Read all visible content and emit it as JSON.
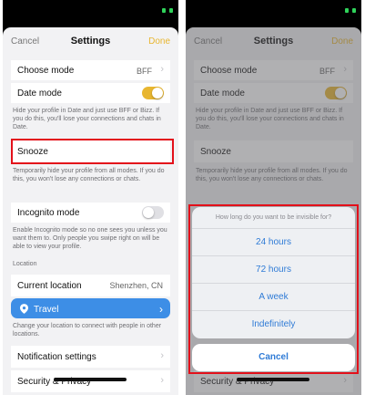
{
  "settings": {
    "cancel_label": "Cancel",
    "title": "Settings",
    "done_label": "Done",
    "choose_mode": {
      "label": "Choose mode",
      "value": "BFF"
    },
    "date_mode": {
      "label": "Date mode",
      "enabled": true,
      "description": "Hide your profile in Date and just use BFF or Bizz. If you do this, you'll lose your connections and chats in Date."
    },
    "snooze": {
      "label": "Snooze",
      "description": "Temporarily hide your profile from all modes. If you do this, you won't lose any connections or chats."
    },
    "incognito_mode": {
      "label": "Incognito mode",
      "enabled": false,
      "description": "Enable Incognito mode so no one sees you unless you want them to. Only people you swipe right on will be able to view your profile."
    },
    "location_section": "Location",
    "current_location": {
      "label": "Current location",
      "value": "Shenzhen, CN"
    },
    "travel": {
      "label": "Travel",
      "description": "Change your location to connect with people in other locations."
    },
    "notification_settings": "Notification settings",
    "security_privacy": "Security & Privacy"
  },
  "snooze_sheet": {
    "title": "How long do you want to be invisible for?",
    "options": [
      "24 hours",
      "72 hours",
      "A week",
      "Indefinitely"
    ],
    "cancel_label": "Cancel"
  },
  "colors": {
    "accent_yellow": "#e8b630",
    "travel_blue": "#3d8ee6",
    "action_blue": "#2f7bd6",
    "highlight_red": "#e3101a"
  }
}
